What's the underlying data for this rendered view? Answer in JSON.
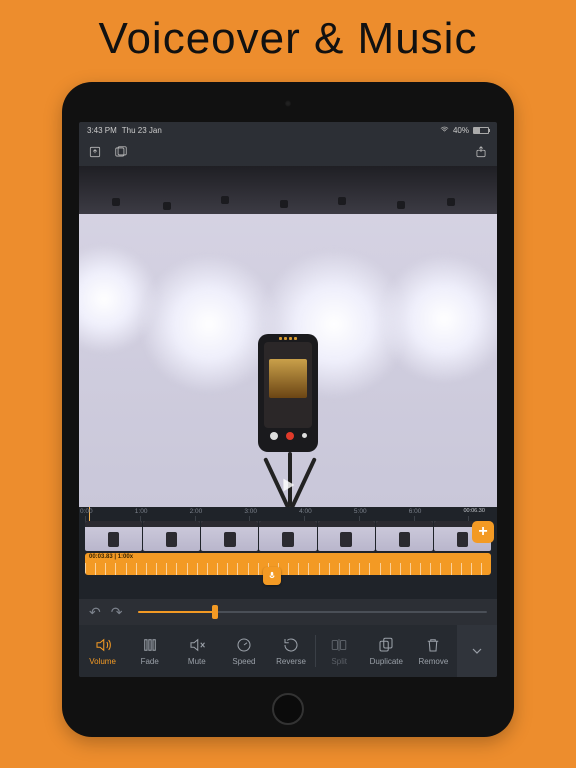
{
  "headline": "Voiceover & Music",
  "status": {
    "time": "3:43 PM",
    "date": "Thu 23 Jan",
    "battery_pct": "40%"
  },
  "timeline": {
    "ticks": [
      "0:00",
      "1:00",
      "2:00",
      "3:00",
      "4:00",
      "5:00",
      "6:00"
    ],
    "final_tick": "00:06.30",
    "audio_clip_label": "00:03.83 | 1:00x",
    "add_label": "+"
  },
  "tools": {
    "volume": "Volume",
    "fade": "Fade",
    "mute": "Mute",
    "speed": "Speed",
    "reverse": "Reverse",
    "split": "Split",
    "duplicate": "Duplicate",
    "remove": "Remove"
  }
}
